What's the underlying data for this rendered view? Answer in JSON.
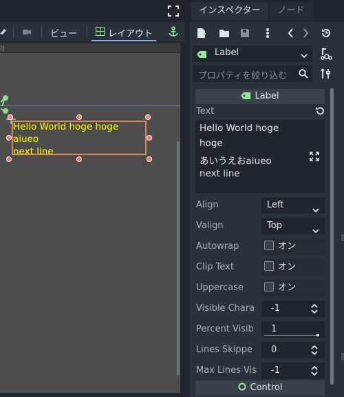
{
  "viewport": {
    "toolbar": {
      "view_label": "ビュー",
      "layout_label": "レイアウト"
    },
    "label_text_lines": [
      "Hello World hoge hoge",
      "aiueo",
      "next line"
    ]
  },
  "inspector": {
    "tabs": [
      {
        "label": "インスペクター",
        "active": true
      },
      {
        "label": "ノード",
        "active": false
      }
    ],
    "node_selector": {
      "value": "Label"
    },
    "filter": {
      "placeholder": "プロパティを絞り込む"
    },
    "section_title": "Label",
    "text_property": {
      "label": "Text",
      "value_lines": [
        "Hello World hoge",
        "hoge",
        "あいうえおaiueo",
        "next line"
      ]
    },
    "properties": [
      {
        "label": "Align",
        "value": "Left",
        "kind": "dropdown"
      },
      {
        "label": "Valign",
        "value": "Top",
        "kind": "dropdown"
      },
      {
        "label": "Autowrap",
        "value": "オン",
        "kind": "checkbox"
      },
      {
        "label": "Clip Text",
        "value": "オン",
        "kind": "checkbox"
      },
      {
        "label": "Uppercase",
        "value": "オン",
        "kind": "checkbox"
      },
      {
        "label": "Visible Chara",
        "value": "-1",
        "kind": "spin"
      },
      {
        "label": "Percent Visib",
        "value": "1",
        "kind": "slider"
      },
      {
        "label": "Lines Skippe",
        "value": "0",
        "kind": "spin"
      },
      {
        "label": "Max Lines Vis",
        "value": "-1",
        "kind": "spin"
      }
    ],
    "footer_section": "Control"
  },
  "colors": {
    "accent": "#8da5f3",
    "selection": "#e08a4f",
    "label_text": "#ffff00",
    "handle": "#f2776e",
    "pivot": "#8ed98e",
    "label_icon": "#8eef97"
  }
}
